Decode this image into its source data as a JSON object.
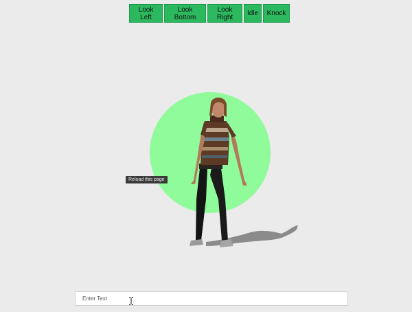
{
  "toolbar": {
    "look_left": "Look Left",
    "look_bottom": "Look Bottom",
    "look_right": "Look Right",
    "idle": "Idle",
    "knock": "Knock"
  },
  "scene": {
    "circle_color": "#90fb9a",
    "figure": "3d-character-woman",
    "tooltip": "Reload this page"
  },
  "input": {
    "placeholder": "Enter Text",
    "value": ""
  },
  "colors": {
    "button_bg": "#2cb85e",
    "background": "#ebebeb"
  }
}
